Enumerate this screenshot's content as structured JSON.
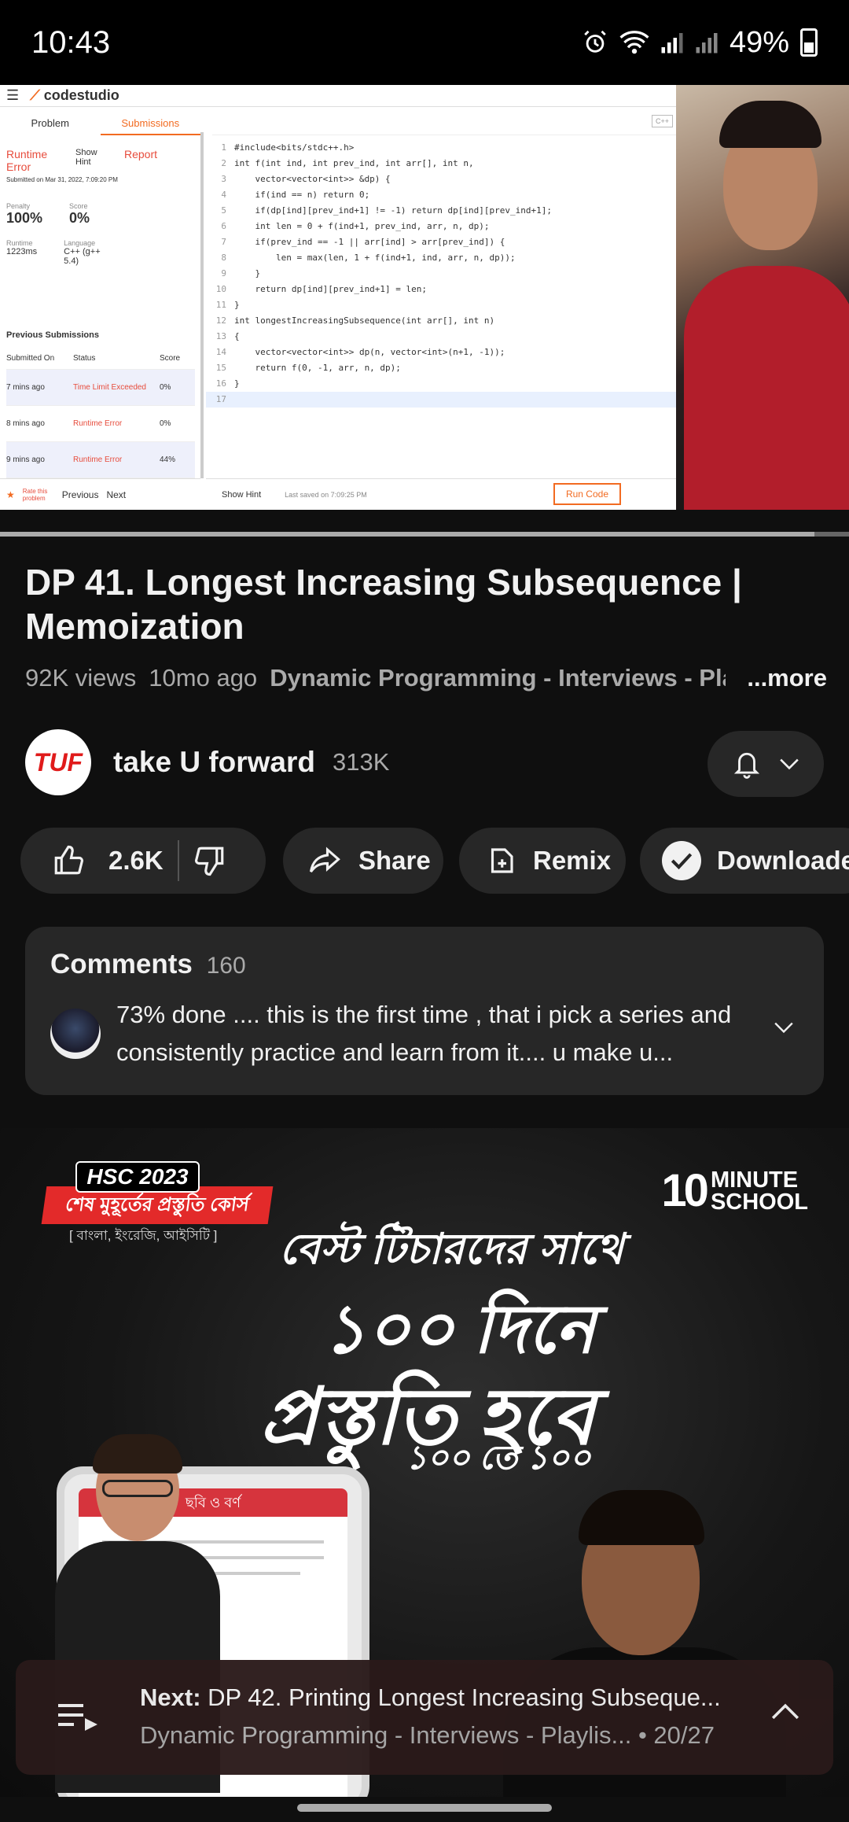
{
  "status": {
    "time": "10:43",
    "battery": "49%"
  },
  "video": {
    "app_name": "codestudio",
    "tabs": [
      "Problem",
      "Submissions"
    ],
    "result": "Runtime Error",
    "show_hint": "Show Hint",
    "report": "Report",
    "submitted": "Submitted on Mar 31, 2022, 7:09:20 PM",
    "penalty_label": "Penalty",
    "penalty": "100%",
    "score_label": "Score",
    "score": "0%",
    "runtime_label": "Runtime",
    "runtime": "1223ms",
    "language_label": "Language",
    "language": "C++ (g++ 5.4)",
    "prev_title": "Previous Submissions",
    "table_headers": [
      "Submitted On",
      "Status",
      "Score"
    ],
    "rows": [
      {
        "when": "7 mins ago",
        "status": "Time Limit Exceeded",
        "score": "0%"
      },
      {
        "when": "8 mins ago",
        "status": "Runtime Error",
        "score": "0%"
      },
      {
        "when": "9 mins ago",
        "status": "Runtime Error",
        "score": "44%"
      }
    ],
    "rate": "Rate this problem",
    "previous": "Previous",
    "next": "Next",
    "code": [
      "#include<bits/stdc++.h>",
      "int f(int ind, int prev_ind, int arr[], int n,",
      "    vector<vector<int>> &dp) {",
      "    if(ind == n) return 0;",
      "    if(dp[ind][prev_ind+1] != -1) return dp[ind][prev_ind+1];",
      "    int len = 0 + f(ind+1, prev_ind, arr, n, dp);",
      "    if(prev_ind == -1 || arr[ind] > arr[prev_ind]) {",
      "        len = max(len, 1 + f(ind+1, ind, arr, n, dp));",
      "    }",
      "    return dp[ind][prev_ind+1] = len;",
      "}",
      "int longestIncreasingSubsequence(int arr[], int n)",
      "{",
      "    vector<vector<int>> dp(n, vector<int>(n+1, -1));",
      "    return f(0, -1, arr, n, dp);",
      "}",
      ""
    ],
    "lang_badge": "C++",
    "show_hint_bottom": "Show Hint",
    "last_saved": "Last saved on 7:09:25 PM",
    "run_code": "Run Code"
  },
  "title": "DP 41. Longest Increasing Subsequence | Memoization",
  "views": "92K views",
  "age": "10mo ago",
  "playlist_link": "Dynamic Programming - Interviews - Pla",
  "more": "...more",
  "channel": {
    "name": "take U forward",
    "subs": "313K",
    "avatar_text": "TUF"
  },
  "actions": {
    "likes": "2.6K",
    "share": "Share",
    "remix": "Remix",
    "download": "Downloaded"
  },
  "comments": {
    "label": "Comments",
    "count": "160",
    "top": "73% done .... this is the first time , that i pick a series and consistently practice and learn from it.... u make u..."
  },
  "ad": {
    "hsc": "HSC 2023",
    "course": "শেষ মুহূর্তের প্রস্তুতি কোর্স",
    "subjects": "[ বাংলা, ইংরেজি, আইসিটি ]",
    "brand_num": "10",
    "brand_text1": "MINUTE",
    "brand_text2": "SCHOOL",
    "line1": "বেস্ট টিচারদের সাথে",
    "line2": "১০০ দিনে",
    "line3": "প্রস্তুতি হবে",
    "line4": "১০০ তে ১০০",
    "tablet_bar": "ছবি ও বর্ণ"
  },
  "next": {
    "label": "Next:",
    "title": "DP 42. Printing Longest Increasing Subseque...",
    "playlist": "Dynamic Programming - Interviews - Playlis...",
    "position": "• 20/27"
  },
  "colors": {
    "background": "#0f0f0f",
    "surface": "#272727",
    "accent": "#f26b21",
    "error": "#e74c3c"
  }
}
